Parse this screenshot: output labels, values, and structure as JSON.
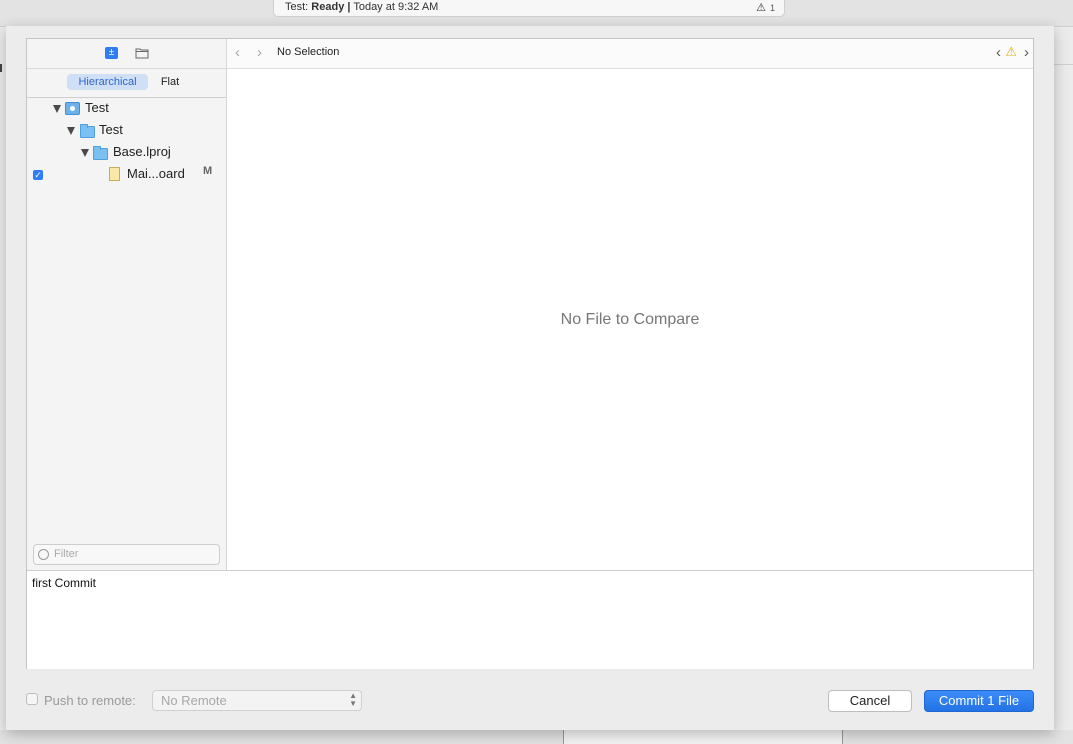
{
  "activity": {
    "project": "Test:",
    "status": "Ready",
    "separator": "|",
    "time": "Today at 9:32 AM",
    "warning_count": "1"
  },
  "sidebar": {
    "segments": {
      "hierarchical": "Hierarchical",
      "flat": "Flat"
    },
    "tree": [
      {
        "label": "Test",
        "kind": "project"
      },
      {
        "label": "Test",
        "kind": "folder"
      },
      {
        "label": "Base.lproj",
        "kind": "folder"
      },
      {
        "label": "Mai...oard",
        "kind": "file",
        "status": "M",
        "checked": true
      }
    ],
    "filter_placeholder": "Filter"
  },
  "navbar": {
    "title": "No Selection"
  },
  "diff": {
    "empty_message": "No File to Compare"
  },
  "commit_message": "first Commit",
  "footer": {
    "push_label": "Push to remote:",
    "remote_value": "No Remote",
    "cancel_label": "Cancel",
    "commit_label": "Commit 1 File"
  },
  "colors": {
    "accent": "#2e7cf6",
    "warning": "#e0b010"
  }
}
